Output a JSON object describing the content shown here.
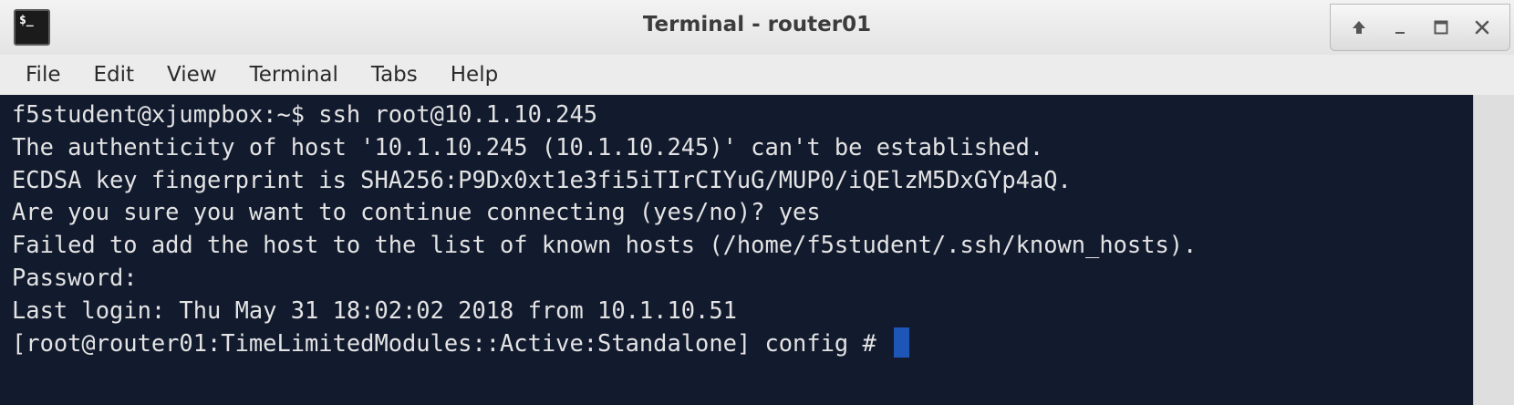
{
  "window": {
    "title": "Terminal - router01",
    "icon_glyph": "$_",
    "icon_name": "terminal-icon",
    "controls": [
      "maximize-up-icon",
      "minimize-icon",
      "restore-icon",
      "close-icon"
    ]
  },
  "menu": {
    "items": [
      "File",
      "Edit",
      "View",
      "Terminal",
      "Tabs",
      "Help"
    ]
  },
  "terminal": {
    "background": "#121a2e",
    "foreground": "#e3e3e3",
    "cursor_color": "#1e56b8",
    "lines": [
      "f5student@xjumpbox:~$ ssh root@10.1.10.245",
      "The authenticity of host '10.1.10.245 (10.1.10.245)' can't be established.",
      "ECDSA key fingerprint is SHA256:P9Dx0xt1e3fi5iTIrCIYuG/MUP0/iQElzM5DxGYp4aQ.",
      "Are you sure you want to continue connecting (yes/no)? yes",
      "Failed to add the host to the list of known hosts (/home/f5student/.ssh/known_hosts).",
      "Password:",
      "Last login: Thu May 31 18:02:02 2018 from 10.1.10.51",
      "[root@router01:TimeLimitedModules::Active:Standalone] config # "
    ]
  }
}
